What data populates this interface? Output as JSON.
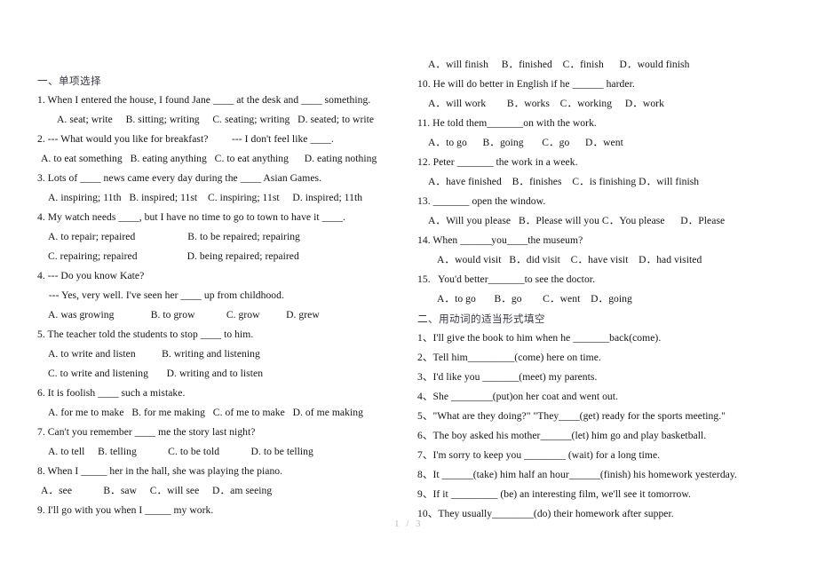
{
  "document": {
    "footer_page": "1 / 3"
  },
  "left_column": {
    "section_one_heading": "一、单项选择",
    "lines": [
      {
        "indent": "indent0",
        "text": "1. When I entered the house, I found Jane ____ at the desk and ____ something."
      },
      {
        "indent": "indent2",
        "text": "A. seat; write     B. sitting; writing     C. seating; writing   D. seated; to write"
      },
      {
        "indent": "indent0",
        "text": "2. --- What would you like for breakfast?         --- I don't feel like ____."
      },
      {
        "indent": "outdent",
        "text": "A. to eat something   B. eating anything   C. to eat anything      D. eating nothing"
      },
      {
        "indent": "indent0",
        "text": "3. Lots of ____ news came every day during the ____ Asian Games."
      },
      {
        "indent": "indent1",
        "text": "A. inspiring; 11th   B. inspired; 11st    C. inspiring; 11st     D. inspired; 11th"
      },
      {
        "indent": "indent0",
        "text": "4. My watch needs ____, but I have no time to go to town to have it ____."
      },
      {
        "indent": "indent1",
        "text": "A. to repair; repaired                    B. to be repaired; repairing"
      },
      {
        "indent": "indent1",
        "text": "C. repairing; repaired                   D. being repaired; repaired"
      },
      {
        "indent": "indent0",
        "text": "4. --- Do you know Kate?"
      },
      {
        "indent": "outdent",
        "text": "   --- Yes, very well. I've seen her ____ up from childhood."
      },
      {
        "indent": "indent1",
        "text": "A. was growing              B. to grow            C. grow          D. grew"
      },
      {
        "indent": "indent0",
        "text": "5. The teacher told the students to stop ____ to him."
      },
      {
        "indent": "indent1",
        "text": "A. to write and listen          B. writing and listening"
      },
      {
        "indent": "indent1",
        "text": "C. to write and listening       D. writing and to listen"
      },
      {
        "indent": "indent0",
        "text": "6. It is foolish ____ such a mistake."
      },
      {
        "indent": "indent1",
        "text": "A. for me to make   B. for me making   C. of me to make   D. of me making"
      },
      {
        "indent": "indent0",
        "text": "7. Can't you remember ____ me the story last night?"
      },
      {
        "indent": "indent1",
        "text": "A. to tell     B. telling            C. to be told            D. to be telling"
      },
      {
        "indent": "indent0",
        "text": "8. When I _____ her in the hall, she was playing the piano."
      },
      {
        "indent": "outdent",
        "text": "A．see            B．saw     C．will see     D．am seeing"
      },
      {
        "indent": "indent0",
        "text": "9. I'll go with you when I _____ my work."
      }
    ]
  },
  "right_column": {
    "section_two_heading": "二、用动词的适当形式填空",
    "lines_before_heading": [
      {
        "indent": "indent1",
        "text": "A．will finish     B．finished    C．finish      D．would finish"
      },
      {
        "indent": "indent0",
        "text": "10. He will do better in English if he ______ harder."
      },
      {
        "indent": "indent1",
        "text": "A．will work        B．works    C．working     D．work"
      },
      {
        "indent": "indent0",
        "text": "11. He told them_______on with the work."
      },
      {
        "indent": "indent1",
        "text": "A．to go      B．going       C．go      D．went"
      },
      {
        "indent": "indent0",
        "text": "12. Peter _______ the work in a week."
      },
      {
        "indent": "indent1",
        "text": "A．have finished    B．finishes    C．is finishing D．will finish"
      },
      {
        "indent": "indent0",
        "text": "13. _______ open the window."
      },
      {
        "indent": "indent1",
        "text": "A．Will you please   B．Please will you C．You please      D．Please"
      },
      {
        "indent": "indent0",
        "text": "14. When ______you____the museum?"
      },
      {
        "indent": "indent2",
        "text": "A．would visit   B．did visit    C．have visit    D．had visited"
      },
      {
        "indent": "indent0",
        "text": "15.   You'd better_______to see the doctor."
      },
      {
        "indent": "indent2",
        "text": "A．to go       B．go        C．went    D．going"
      }
    ],
    "lines_after_heading": [
      {
        "indent": "indent0",
        "text": "1、I'll give the book to him when he _______back(come)."
      },
      {
        "indent": "indent0",
        "text": "2、Tell him_________(come) here on time."
      },
      {
        "indent": "indent0",
        "text": "3、I'd like you _______(meet) my parents."
      },
      {
        "indent": "indent0",
        "text": "4、She ________(put)on her coat and went out."
      },
      {
        "indent": "indent0",
        "text": "5、\"What are they doing?\" \"They____(get) ready for the sports meeting.\""
      },
      {
        "indent": "indent0",
        "text": "6、The boy asked his mother______(let) him go and play basketball."
      },
      {
        "indent": "indent0",
        "text": "7、I'm sorry to keep you ________ (wait) for a long time."
      },
      {
        "indent": "indent0",
        "text": "8、It ______(take) him half an hour______(finish) his homework yesterday."
      },
      {
        "indent": "indent0",
        "text": "9、If it _________ (be) an interesting film, we'll see it tomorrow."
      },
      {
        "indent": "indent0",
        "text": "10、They usually________(do) their homework after supper."
      }
    ]
  }
}
